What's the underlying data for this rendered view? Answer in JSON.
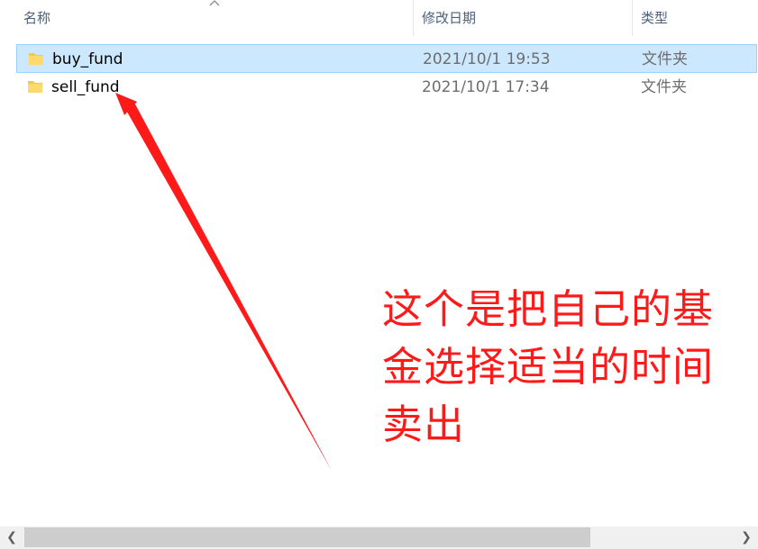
{
  "columns": {
    "name": "名称",
    "date_modified": "修改日期",
    "type": "类型"
  },
  "files": [
    {
      "name": "buy_fund",
      "date": "2021/10/1 19:53",
      "type": "文件夹",
      "selected": true
    },
    {
      "name": "sell_fund",
      "date": "2021/10/1 17:34",
      "type": "文件夹",
      "selected": false
    }
  ],
  "annotation": {
    "line1": "这个是把自己的基",
    "line2": "金选择适当的时间",
    "line3": "卖出",
    "color": "#ff1a1a"
  },
  "colors": {
    "selection_bg": "#cce8ff",
    "selection_border": "#99d1ff",
    "folder": "#f4c84a"
  },
  "icons": {
    "sort": "sort-ascending-icon",
    "folder": "folder-icon",
    "scroll_left": "scroll-left-icon",
    "scroll_right": "scroll-right-icon"
  }
}
